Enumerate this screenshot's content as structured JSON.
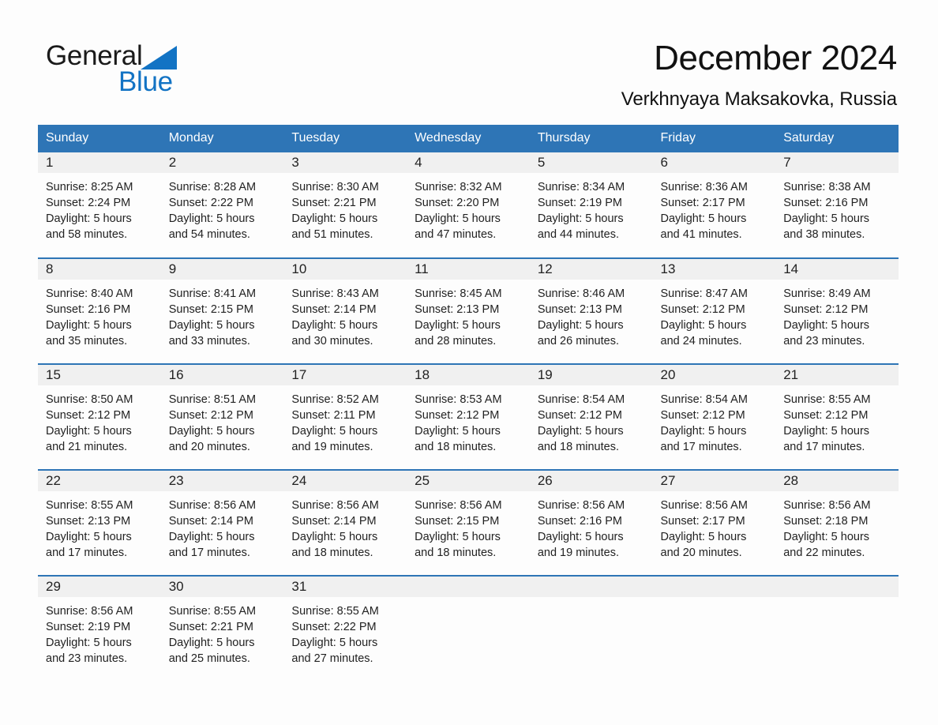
{
  "logo": {
    "word1": "General",
    "word2": "Blue",
    "triangle_color": "#1273c4",
    "word2_color": "#1273c4"
  },
  "header": {
    "title": "December 2024",
    "subtitle": "Verkhnyaya Maksakovka, Russia"
  },
  "theme": {
    "header_blue": "#2e75b6",
    "daynum_band": "#f0f0f0",
    "page_background": "#fdfdfd"
  },
  "calendar": {
    "weekday_headers": [
      "Sunday",
      "Monday",
      "Tuesday",
      "Wednesday",
      "Thursday",
      "Friday",
      "Saturday"
    ],
    "weeks": [
      [
        {
          "day": "1",
          "sunrise": "Sunrise: 8:25 AM",
          "sunset": "Sunset: 2:24 PM",
          "daylight_line1": "Daylight: 5 hours",
          "daylight_line2": "and 58 minutes."
        },
        {
          "day": "2",
          "sunrise": "Sunrise: 8:28 AM",
          "sunset": "Sunset: 2:22 PM",
          "daylight_line1": "Daylight: 5 hours",
          "daylight_line2": "and 54 minutes."
        },
        {
          "day": "3",
          "sunrise": "Sunrise: 8:30 AM",
          "sunset": "Sunset: 2:21 PM",
          "daylight_line1": "Daylight: 5 hours",
          "daylight_line2": "and 51 minutes."
        },
        {
          "day": "4",
          "sunrise": "Sunrise: 8:32 AM",
          "sunset": "Sunset: 2:20 PM",
          "daylight_line1": "Daylight: 5 hours",
          "daylight_line2": "and 47 minutes."
        },
        {
          "day": "5",
          "sunrise": "Sunrise: 8:34 AM",
          "sunset": "Sunset: 2:19 PM",
          "daylight_line1": "Daylight: 5 hours",
          "daylight_line2": "and 44 minutes."
        },
        {
          "day": "6",
          "sunrise": "Sunrise: 8:36 AM",
          "sunset": "Sunset: 2:17 PM",
          "daylight_line1": "Daylight: 5 hours",
          "daylight_line2": "and 41 minutes."
        },
        {
          "day": "7",
          "sunrise": "Sunrise: 8:38 AM",
          "sunset": "Sunset: 2:16 PM",
          "daylight_line1": "Daylight: 5 hours",
          "daylight_line2": "and 38 minutes."
        }
      ],
      [
        {
          "day": "8",
          "sunrise": "Sunrise: 8:40 AM",
          "sunset": "Sunset: 2:16 PM",
          "daylight_line1": "Daylight: 5 hours",
          "daylight_line2": "and 35 minutes."
        },
        {
          "day": "9",
          "sunrise": "Sunrise: 8:41 AM",
          "sunset": "Sunset: 2:15 PM",
          "daylight_line1": "Daylight: 5 hours",
          "daylight_line2": "and 33 minutes."
        },
        {
          "day": "10",
          "sunrise": "Sunrise: 8:43 AM",
          "sunset": "Sunset: 2:14 PM",
          "daylight_line1": "Daylight: 5 hours",
          "daylight_line2": "and 30 minutes."
        },
        {
          "day": "11",
          "sunrise": "Sunrise: 8:45 AM",
          "sunset": "Sunset: 2:13 PM",
          "daylight_line1": "Daylight: 5 hours",
          "daylight_line2": "and 28 minutes."
        },
        {
          "day": "12",
          "sunrise": "Sunrise: 8:46 AM",
          "sunset": "Sunset: 2:13 PM",
          "daylight_line1": "Daylight: 5 hours",
          "daylight_line2": "and 26 minutes."
        },
        {
          "day": "13",
          "sunrise": "Sunrise: 8:47 AM",
          "sunset": "Sunset: 2:12 PM",
          "daylight_line1": "Daylight: 5 hours",
          "daylight_line2": "and 24 minutes."
        },
        {
          "day": "14",
          "sunrise": "Sunrise: 8:49 AM",
          "sunset": "Sunset: 2:12 PM",
          "daylight_line1": "Daylight: 5 hours",
          "daylight_line2": "and 23 minutes."
        }
      ],
      [
        {
          "day": "15",
          "sunrise": "Sunrise: 8:50 AM",
          "sunset": "Sunset: 2:12 PM",
          "daylight_line1": "Daylight: 5 hours",
          "daylight_line2": "and 21 minutes."
        },
        {
          "day": "16",
          "sunrise": "Sunrise: 8:51 AM",
          "sunset": "Sunset: 2:12 PM",
          "daylight_line1": "Daylight: 5 hours",
          "daylight_line2": "and 20 minutes."
        },
        {
          "day": "17",
          "sunrise": "Sunrise: 8:52 AM",
          "sunset": "Sunset: 2:11 PM",
          "daylight_line1": "Daylight: 5 hours",
          "daylight_line2": "and 19 minutes."
        },
        {
          "day": "18",
          "sunrise": "Sunrise: 8:53 AM",
          "sunset": "Sunset: 2:12 PM",
          "daylight_line1": "Daylight: 5 hours",
          "daylight_line2": "and 18 minutes."
        },
        {
          "day": "19",
          "sunrise": "Sunrise: 8:54 AM",
          "sunset": "Sunset: 2:12 PM",
          "daylight_line1": "Daylight: 5 hours",
          "daylight_line2": "and 18 minutes."
        },
        {
          "day": "20",
          "sunrise": "Sunrise: 8:54 AM",
          "sunset": "Sunset: 2:12 PM",
          "daylight_line1": "Daylight: 5 hours",
          "daylight_line2": "and 17 minutes."
        },
        {
          "day": "21",
          "sunrise": "Sunrise: 8:55 AM",
          "sunset": "Sunset: 2:12 PM",
          "daylight_line1": "Daylight: 5 hours",
          "daylight_line2": "and 17 minutes."
        }
      ],
      [
        {
          "day": "22",
          "sunrise": "Sunrise: 8:55 AM",
          "sunset": "Sunset: 2:13 PM",
          "daylight_line1": "Daylight: 5 hours",
          "daylight_line2": "and 17 minutes."
        },
        {
          "day": "23",
          "sunrise": "Sunrise: 8:56 AM",
          "sunset": "Sunset: 2:14 PM",
          "daylight_line1": "Daylight: 5 hours",
          "daylight_line2": "and 17 minutes."
        },
        {
          "day": "24",
          "sunrise": "Sunrise: 8:56 AM",
          "sunset": "Sunset: 2:14 PM",
          "daylight_line1": "Daylight: 5 hours",
          "daylight_line2": "and 18 minutes."
        },
        {
          "day": "25",
          "sunrise": "Sunrise: 8:56 AM",
          "sunset": "Sunset: 2:15 PM",
          "daylight_line1": "Daylight: 5 hours",
          "daylight_line2": "and 18 minutes."
        },
        {
          "day": "26",
          "sunrise": "Sunrise: 8:56 AM",
          "sunset": "Sunset: 2:16 PM",
          "daylight_line1": "Daylight: 5 hours",
          "daylight_line2": "and 19 minutes."
        },
        {
          "day": "27",
          "sunrise": "Sunrise: 8:56 AM",
          "sunset": "Sunset: 2:17 PM",
          "daylight_line1": "Daylight: 5 hours",
          "daylight_line2": "and 20 minutes."
        },
        {
          "day": "28",
          "sunrise": "Sunrise: 8:56 AM",
          "sunset": "Sunset: 2:18 PM",
          "daylight_line1": "Daylight: 5 hours",
          "daylight_line2": "and 22 minutes."
        }
      ],
      [
        {
          "day": "29",
          "sunrise": "Sunrise: 8:56 AM",
          "sunset": "Sunset: 2:19 PM",
          "daylight_line1": "Daylight: 5 hours",
          "daylight_line2": "and 23 minutes."
        },
        {
          "day": "30",
          "sunrise": "Sunrise: 8:55 AM",
          "sunset": "Sunset: 2:21 PM",
          "daylight_line1": "Daylight: 5 hours",
          "daylight_line2": "and 25 minutes."
        },
        {
          "day": "31",
          "sunrise": "Sunrise: 8:55 AM",
          "sunset": "Sunset: 2:22 PM",
          "daylight_line1": "Daylight: 5 hours",
          "daylight_line2": "and 27 minutes."
        },
        {
          "day": "",
          "sunrise": "",
          "sunset": "",
          "daylight_line1": "",
          "daylight_line2": ""
        },
        {
          "day": "",
          "sunrise": "",
          "sunset": "",
          "daylight_line1": "",
          "daylight_line2": ""
        },
        {
          "day": "",
          "sunrise": "",
          "sunset": "",
          "daylight_line1": "",
          "daylight_line2": ""
        },
        {
          "day": "",
          "sunrise": "",
          "sunset": "",
          "daylight_line1": "",
          "daylight_line2": ""
        }
      ]
    ]
  }
}
